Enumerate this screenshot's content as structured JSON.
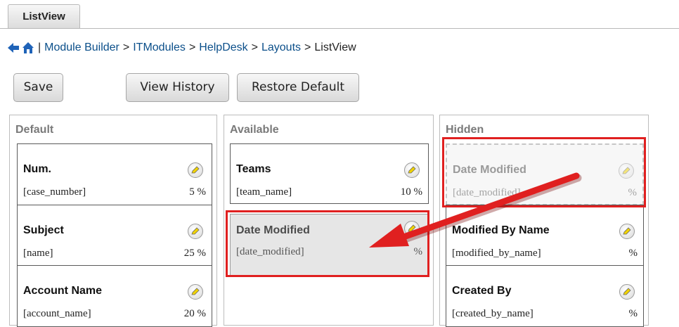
{
  "tab": {
    "label": "ListView"
  },
  "breadcrumb": {
    "items": [
      "Module Builder",
      "ITModules",
      "HelpDesk",
      "Layouts"
    ],
    "separator": ">",
    "pipe": "|",
    "current": "ListView"
  },
  "buttons": {
    "save": "Save",
    "history": "View History",
    "restore": "Restore Default"
  },
  "columns": {
    "default": {
      "title": "Default",
      "fields": [
        {
          "label": "Num.",
          "name": "[case_number]",
          "width": "5 %"
        },
        {
          "label": "Subject",
          "name": "[name]",
          "width": "25 %"
        },
        {
          "label": "Account Name",
          "name": "[account_name]",
          "width": "20 %"
        }
      ]
    },
    "available": {
      "title": "Available",
      "fields": [
        {
          "label": "Teams",
          "name": "[team_name]",
          "width": "10 %"
        },
        {
          "label": "Date Modified",
          "name": "[date_modified]",
          "width": "%"
        }
      ]
    },
    "hidden": {
      "title": "Hidden",
      "fields": [
        {
          "label": "Date Modified",
          "name": "[date_modified]",
          "width": "%"
        },
        {
          "label": "Modified By Name",
          "name": "[modified_by_name]",
          "width": "%"
        },
        {
          "label": "Created By",
          "name": "[created_by_name]",
          "width": "%"
        }
      ]
    }
  },
  "colors": {
    "highlight": "#e02020",
    "link": "#0b4f8a",
    "column_title": "#7a7a7a"
  },
  "icons": {
    "back": "left-arrow-icon",
    "home": "home-icon",
    "edit": "pencil-icon"
  }
}
